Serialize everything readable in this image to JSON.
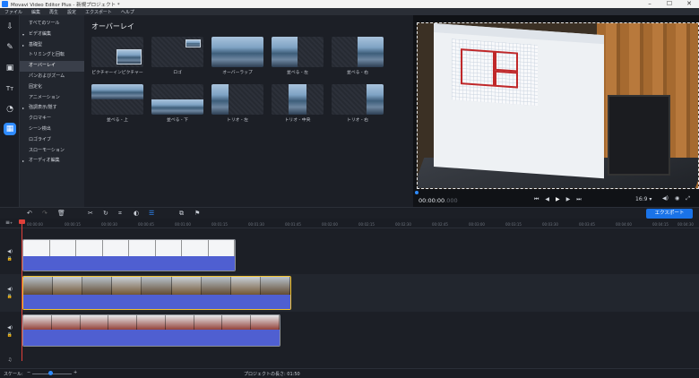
{
  "window": {
    "title": "Movavi Video Editor Plus - 新規プロジェクト *"
  },
  "menu": [
    "ファイル",
    "編集",
    "再生",
    "設定",
    "エクスポート",
    "ヘルプ"
  ],
  "left_icons": [
    "import-icon",
    "magic-wand-icon",
    "filters-icon",
    "titles-icon",
    "transitions-icon",
    "more-tools-icon"
  ],
  "categories": [
    {
      "label": "すべてのツール",
      "arrow": "",
      "sel": false
    },
    {
      "label": "ビデオ編集",
      "arrow": "▾",
      "sel": false
    },
    {
      "label": "基礎型",
      "arrow": "▸",
      "sel": false
    },
    {
      "label": "トリミングと回転",
      "arrow": "",
      "sel": false
    },
    {
      "label": "オーバーレイ",
      "arrow": "",
      "sel": true
    },
    {
      "label": "パンおよびズーム",
      "arrow": "",
      "sel": false
    },
    {
      "label": "固定化",
      "arrow": "",
      "sel": false
    },
    {
      "label": "アニメーション",
      "arrow": "",
      "sel": false
    },
    {
      "label": "強調表示/隠す",
      "arrow": "▸",
      "sel": false
    },
    {
      "label": "クロマキー",
      "arrow": "",
      "sel": false
    },
    {
      "label": "シーン検出",
      "arrow": "",
      "sel": false
    },
    {
      "label": "ロゴライブ",
      "arrow": "",
      "sel": false
    },
    {
      "label": "スローモーション",
      "arrow": "",
      "sel": false
    },
    {
      "label": "オーディオ編集",
      "arrow": "▸",
      "sel": false
    }
  ],
  "overlay_title": "オーバーレイ",
  "tiles": [
    {
      "label": "ピクチャーインピクチャー"
    },
    {
      "label": "ロゴ"
    },
    {
      "label": "オーバーラップ"
    },
    {
      "label": "並べる - 左"
    },
    {
      "label": "並べる - 右"
    },
    {
      "label": "並べる - 上"
    },
    {
      "label": "並べる - 下"
    },
    {
      "label": "トリオ - 左"
    },
    {
      "label": "トリオ - 中央"
    },
    {
      "label": "トリオ - 右"
    }
  ],
  "player": {
    "timecode_main": "00:00:00",
    "timecode_frac": ".000",
    "zoom": "16:9 ▾"
  },
  "export_label": "エクスポート",
  "ruler_marks": [
    "00:00:00",
    "00:00:15",
    "00:00:30",
    "00:00:45",
    "00:01:00",
    "00:01:15",
    "00:01:30",
    "00:01:45",
    "00:02:00",
    "00:02:15",
    "00:02:30",
    "00:02:45",
    "00:03:00",
    "00:03:15",
    "00:03:30",
    "00:03:45",
    "00:04:00",
    "00:04:15",
    "00:04:30"
  ],
  "status": {
    "scale_label": "スケール:",
    "project_length": "プロジェクトの長さ: 01:50"
  }
}
